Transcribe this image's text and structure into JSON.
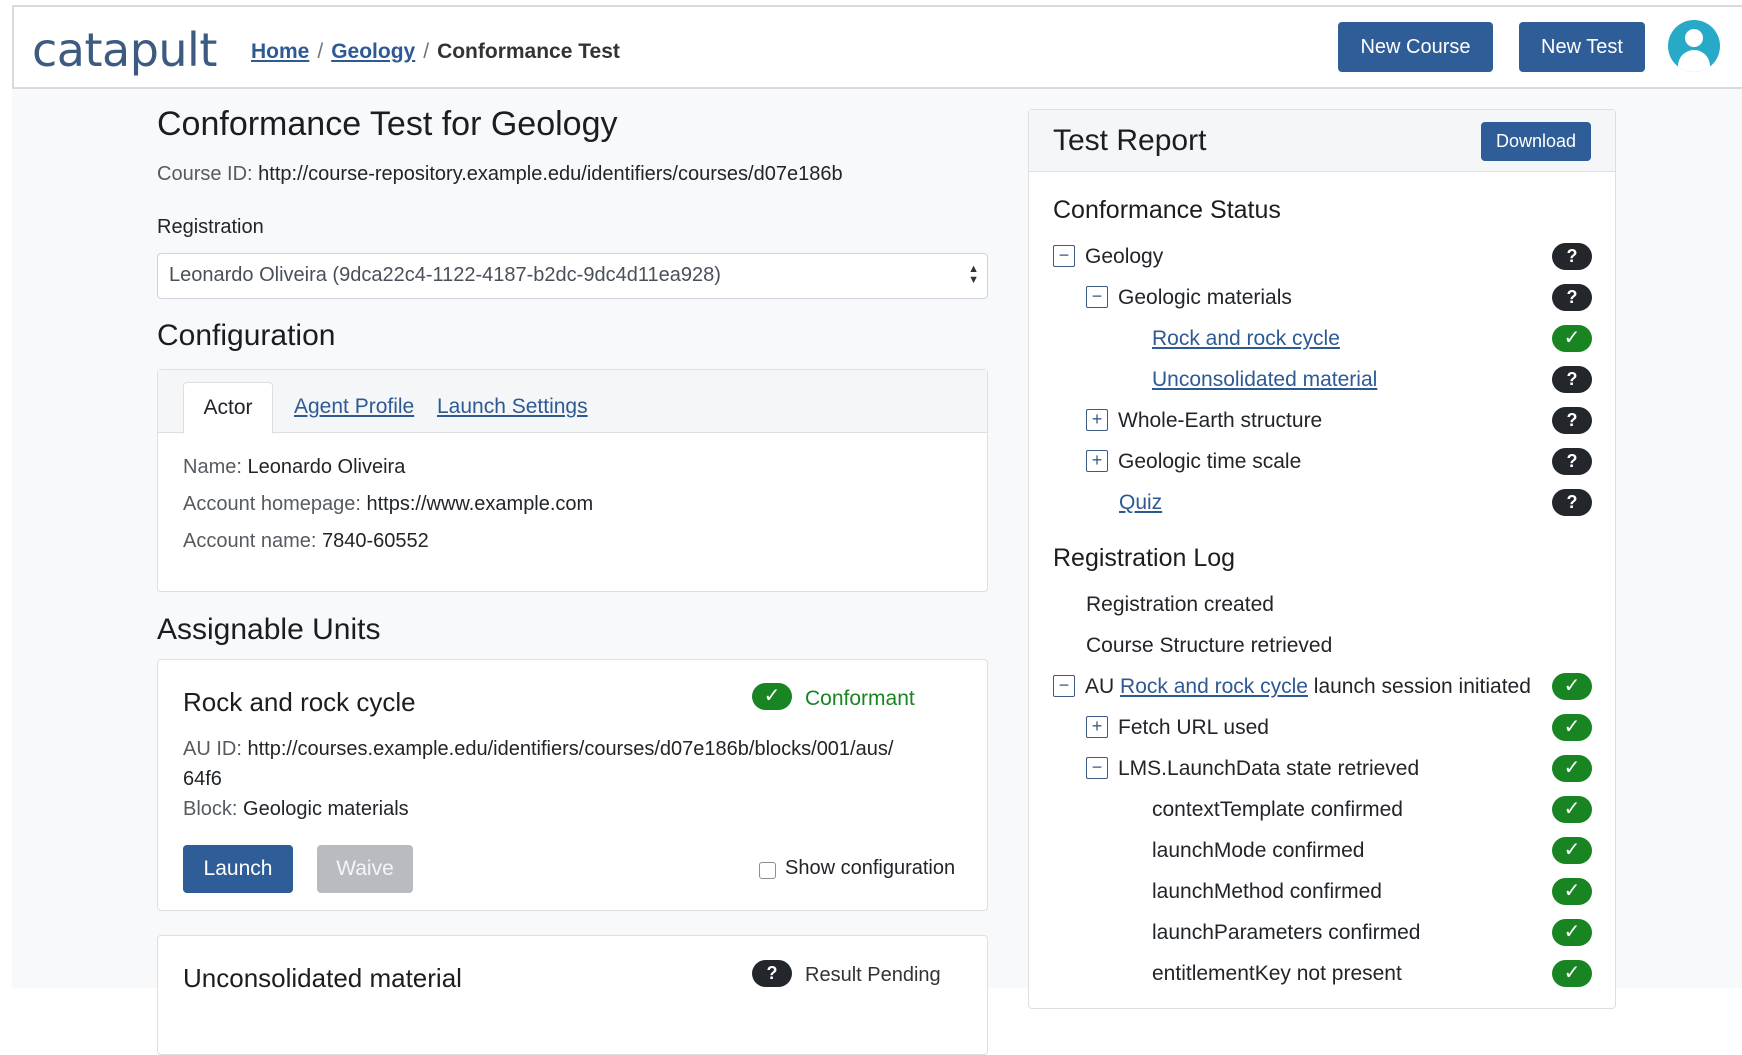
{
  "nav": {
    "brand": "catapult",
    "breadcrumb": {
      "home": "Home",
      "geology": "Geology",
      "current": "Conformance Test",
      "sep": "/"
    },
    "new_course": "New Course",
    "new_test": "New Test"
  },
  "page": {
    "title": "Conformance Test for Geology",
    "course_id_label": "Course ID:",
    "course_id": "http://course-repository.example.edu/identifiers/courses/d07e186b",
    "registration_label": "Registration",
    "registration_value": "Leonardo Oliveira (9dca22c4-1122-4187-b2dc-9dc4d11ea928)"
  },
  "configuration": {
    "heading": "Configuration",
    "tabs": [
      "Actor",
      "Agent Profile",
      "Launch Settings"
    ],
    "actor": {
      "name_label": "Name:",
      "name": "Leonardo Oliveira",
      "homepage_label": "Account homepage:",
      "homepage": "https://www.example.com",
      "account_label": "Account name:",
      "account": "7840-60552"
    }
  },
  "assignable_units": {
    "heading": "Assignable Units",
    "units": [
      {
        "title": "Rock and rock cycle",
        "status": "Conformant",
        "status_icon": "✓",
        "au_id_label": "AU ID:",
        "au_id_line1": "http://courses.example.edu/identifiers/courses/d07e186b/blocks/001/aus/",
        "au_id_line2": "64f6",
        "block_label": "Block:",
        "block": "Geologic materials",
        "launch": "Launch",
        "waive": "Waive",
        "show_config": "Show configuration"
      },
      {
        "title": "Unconsolidated material",
        "status": "Result Pending",
        "status_icon": "?"
      }
    ]
  },
  "report": {
    "title": "Test Report",
    "download": "Download",
    "conformance_heading": "Conformance Status",
    "status": [
      {
        "label": "Geology",
        "toggle": "−",
        "icon": "?",
        "state": "pending"
      },
      {
        "label": "Geologic materials",
        "toggle": "−",
        "icon": "?",
        "state": "pending"
      },
      {
        "label": "Rock and rock cycle",
        "icon": "✓",
        "state": "pass"
      },
      {
        "label": "Unconsolidated material",
        "icon": "?",
        "state": "pending"
      },
      {
        "label": "Whole-Earth structure",
        "toggle": "+",
        "icon": "?",
        "state": "pending"
      },
      {
        "label": "Geologic time scale",
        "toggle": "+",
        "icon": "?",
        "state": "pending"
      },
      {
        "label": "Quiz",
        "icon": "?",
        "state": "pending"
      }
    ],
    "log_heading": "Registration Log",
    "log": [
      {
        "label": "Registration created"
      },
      {
        "label": "Course Structure retrieved"
      },
      {
        "prefix": "AU",
        "link": "Rock and rock cycle",
        "suffix": "launch session initiated",
        "toggle": "−",
        "icon": "✓"
      },
      {
        "label": "Fetch URL used",
        "toggle": "+",
        "icon": "✓"
      },
      {
        "label": "LMS.LaunchData state retrieved",
        "toggle": "−",
        "icon": "✓"
      },
      {
        "label": "contextTemplate confirmed",
        "icon": "✓"
      },
      {
        "label": "launchMode confirmed",
        "icon": "✓"
      },
      {
        "label": "launchMethod confirmed",
        "icon": "✓"
      },
      {
        "label": "launchParameters confirmed",
        "icon": "✓"
      },
      {
        "label": "entitlementKey not present",
        "icon": "✓"
      }
    ]
  },
  "colors": {
    "primary": "#2f5d97",
    "success": "#188522",
    "pending": "#23272b",
    "avatar": "#27a9c8"
  }
}
